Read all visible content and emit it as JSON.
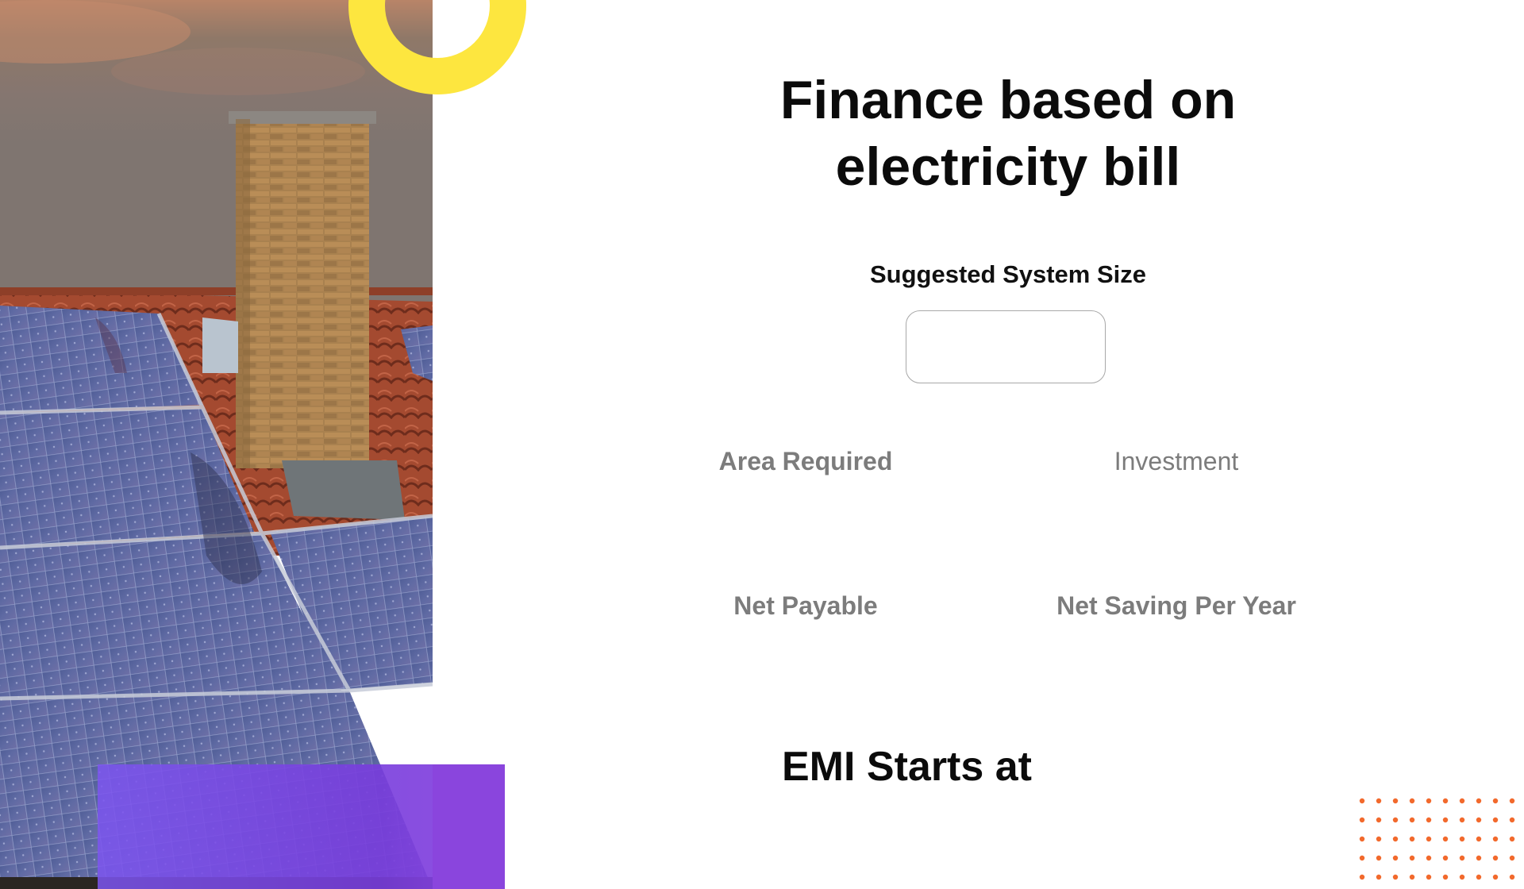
{
  "calculator": {
    "title_line1": "Finance based on",
    "title_line2": "electricity bill",
    "system_size_label": "Suggested System Size",
    "system_size_value": "",
    "area_required_label": "Area Required",
    "area_required_value": "",
    "investment_label": "Investment",
    "investment_value": "",
    "net_payable_label": "Net Payable",
    "net_payable_value": "",
    "net_saving_label": "Net Saving Per Year",
    "net_saving_value": "",
    "emi_label": "EMI Starts at",
    "emi_value": ""
  },
  "colors": {
    "accent_yellow": "#fde63f",
    "accent_purple": "#7b4ae6",
    "accent_orange": "#f2692c",
    "title_text": "#0b0b0b",
    "muted_text": "#7c7c7c"
  },
  "images": {
    "hero_photo": "rooftop-solar-panels-with-brick-chimney"
  }
}
